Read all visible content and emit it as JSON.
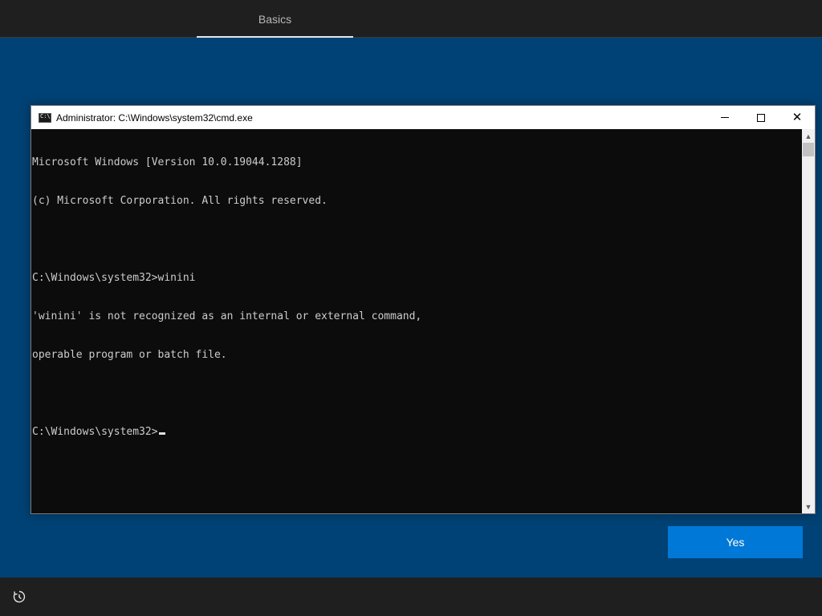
{
  "topbar": {
    "tabs": [
      {
        "label": "Basics",
        "active": true
      }
    ]
  },
  "cmd": {
    "title": "Administrator: C:\\Windows\\system32\\cmd.exe",
    "lines": [
      "Microsoft Windows [Version 10.0.19044.1288]",
      "(c) Microsoft Corporation. All rights reserved.",
      "",
      "C:\\Windows\\system32>winini",
      "'winini' is not recognized as an internal or external command,",
      "operable program or batch file.",
      "",
      "C:\\Windows\\system32>"
    ],
    "controls": {
      "minimize": "minimize-icon",
      "maximize": "maximize-icon",
      "close": "close-icon"
    }
  },
  "dialog": {
    "yes_label": "Yes"
  },
  "bottombar": {
    "accessibility_icon": "accessibility-icon"
  },
  "colors": {
    "background": "#004275",
    "bar": "#1f1f1f",
    "accent_button": "#0078d7",
    "console_bg": "#0c0c0c",
    "console_text": "#cccccc"
  }
}
